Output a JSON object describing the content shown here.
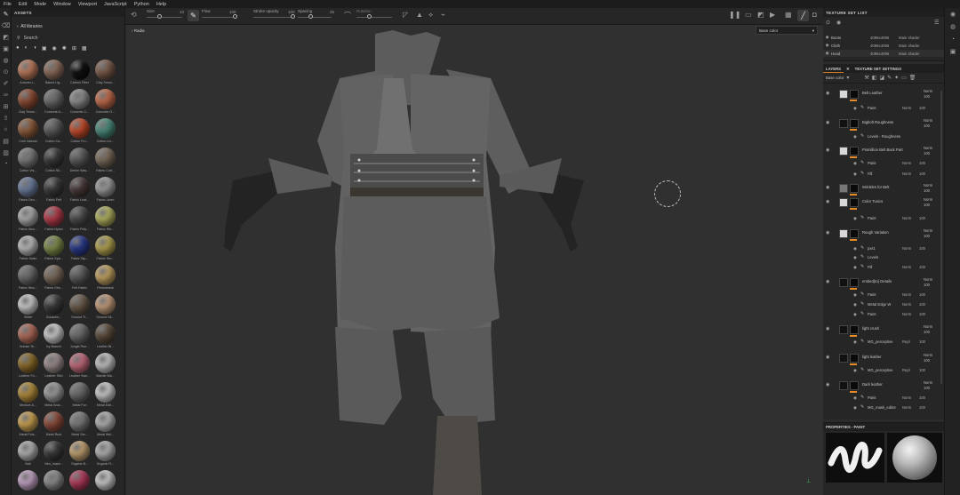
{
  "menu": [
    "File",
    "Edit",
    "Mode",
    "Window",
    "Viewport",
    "JavaScript",
    "Python",
    "Help"
  ],
  "toolbar": {
    "size_label": "Size",
    "size_value": "10",
    "flow_label": "Flow",
    "flow_value": "100",
    "stroke_opacity_label": "Stroke opacity",
    "stroke_opacity_value": "100",
    "spacing_label": "Spacing",
    "spacing_value": "25",
    "rotation_label": "Rotation"
  },
  "assets": {
    "title": "ASSETS",
    "library": "All libraries",
    "search_placeholder": "Search",
    "items": [
      {
        "label": "Autumn L...",
        "color": "#b8785a"
      },
      {
        "label": "Baked Lig...",
        "color": "#8a6a5a"
      },
      {
        "label": "Carbon Fiber",
        "color": "#111111"
      },
      {
        "label": "Clay Smoo...",
        "color": "#7a5a4a"
      },
      {
        "label": "Clay Terrac...",
        "color": "#8a4a32"
      },
      {
        "label": "Concrete A...",
        "color": "#6a6a6a"
      },
      {
        "label": "Concrete C...",
        "color": "#8b8b8b"
      },
      {
        "label": "Concrete G...",
        "color": "#c06a4a"
      },
      {
        "label": "Cork Natural",
        "color": "#8a5a3a"
      },
      {
        "label": "Cotton Ca...",
        "color": "#5a5a5a"
      },
      {
        "label": "Cotton Fro...",
        "color": "#c04a2a"
      },
      {
        "label": "Cotton Lin...",
        "color": "#4a8a7a"
      },
      {
        "label": "Cotton Vis...",
        "color": "#7a7a7a"
      },
      {
        "label": "Cotton Sk...",
        "color": "#3a3a3a"
      },
      {
        "label": "Denim Was...",
        "color": "#5a5a5a"
      },
      {
        "label": "Fabric Cott...",
        "color": "#7a6a5a"
      },
      {
        "label": "Fabric Den...",
        "color": "#6a7a9a"
      },
      {
        "label": "Fabric Felt",
        "color": "#3a3a3a"
      },
      {
        "label": "Fabric Leat...",
        "color": "#4a3a3a"
      },
      {
        "label": "Fabric Linen",
        "color": "#9a9a9a"
      },
      {
        "label": "Fabric Mus...",
        "color": "#aaaaaa"
      },
      {
        "label": "Fabric Nylon",
        "color": "#b03a4a"
      },
      {
        "label": "Fabric Poly...",
        "color": "#4a4a4a"
      },
      {
        "label": "Fabric Rib...",
        "color": "#b0b060"
      },
      {
        "label": "Fabric Swim",
        "color": "#b8b8b8"
      },
      {
        "label": "Fabric Spa...",
        "color": "#7a8a4a"
      },
      {
        "label": "Fabric Tap...",
        "color": "#2a3a8a"
      },
      {
        "label": "Fabric Terr...",
        "color": "#b0a050"
      },
      {
        "label": "Fabric Woo...",
        "color": "#6a6a6a"
      },
      {
        "label": "Fabric Sho...",
        "color": "#7a6a5a"
      },
      {
        "label": "Felt Fabric",
        "color": "#5a5a5a"
      },
      {
        "label": "Fleshwheat",
        "color": "#c0a060"
      },
      {
        "label": "Glitter",
        "color": "#c8c8c8"
      },
      {
        "label": "Gouache...",
        "color": "#3a3a3a"
      },
      {
        "label": "Ground Ti...",
        "color": "#6a5a4a"
      },
      {
        "label": "Ground Sk...",
        "color": "#c09a7a"
      },
      {
        "label": "Human Te...",
        "color": "#b06a5a"
      },
      {
        "label": "Ivy Branch",
        "color": "#c8c8c8"
      },
      {
        "label": "Jungle Run...",
        "color": "#6a6a6a"
      },
      {
        "label": "Leather Bl...",
        "color": "#5a4a3a"
      },
      {
        "label": "Leather Fo...",
        "color": "#8a6a2a"
      },
      {
        "label": "Leather Skin",
        "color": "#9a8a8a"
      },
      {
        "label": "Leather Swe...",
        "color": "#c06a7a"
      },
      {
        "label": "Marble Wa...",
        "color": "#c0c0c0"
      },
      {
        "label": "Medium A...",
        "color": "#b08a3a"
      },
      {
        "label": "Metal Brus...",
        "color": "#9a9a9a"
      },
      {
        "label": "Metal Fon",
        "color": "#6a6a6a"
      },
      {
        "label": "Metal Edit...",
        "color": "#c8c8c8"
      },
      {
        "label": "Metal Pols...",
        "color": "#c8a050"
      },
      {
        "label": "Metal Rust",
        "color": "#8a4a3a"
      },
      {
        "label": "Metal Ser...",
        "color": "#7a7a7a"
      },
      {
        "label": "Metal Wel...",
        "color": "#b0b0b0"
      },
      {
        "label": "Nail",
        "color": "#b0b0b0"
      },
      {
        "label": "Neo_mase...",
        "color": "#3a3a3a"
      },
      {
        "label": "Organic B...",
        "color": "#c0a070"
      },
      {
        "label": "Organic Fl...",
        "color": "#b0b0b0"
      },
      {
        "label": "",
        "color": "#c0a0c0"
      },
      {
        "label": "",
        "color": "#8a8a8a"
      },
      {
        "label": "",
        "color": "#b03a5a"
      },
      {
        "label": "",
        "color": "#c8c8c8"
      }
    ]
  },
  "viewport": {
    "tab": "Radia",
    "channel_select": "Base color"
  },
  "texture_set_list": {
    "title": "TEXTURE SET LIST",
    "rows": [
      {
        "name": "Boots",
        "res": "4096x4096",
        "shader": "Main shader"
      },
      {
        "name": "Cloth",
        "res": "4096x4096",
        "shader": "Main shader"
      },
      {
        "name": "Hood",
        "res": "4096x4096",
        "shader": "Main shader"
      }
    ]
  },
  "layers_panel": {
    "tab_layers": "LAYERS",
    "tab_settings": "TEXTURE SET SETTINGS",
    "channel": "Base color",
    "layers": [
      {
        "name": "Belt Leather",
        "blend": "Norm",
        "opacity": "100",
        "thumb": "light"
      },
      {
        "name": "Bigbolt Roughness",
        "blend": "Norm",
        "opacity": "100",
        "thumb": "dark"
      },
      {
        "name": "Pinmillion Belt Back Part",
        "blend": "Norm",
        "opacity": "100",
        "thumb": "light"
      },
      {
        "name": "Wrinkles for Belt",
        "blend": "Norm",
        "opacity": "100",
        "thumb": "grey"
      },
      {
        "name": "Color Tunics",
        "blend": "Norm",
        "opacity": "100",
        "thumb": "light"
      },
      {
        "name": "Rough Variation",
        "blend": "Norm",
        "opacity": "100",
        "thumb": "light"
      },
      {
        "name": "embed(to) Details",
        "blend": "Norm",
        "opacity": "100",
        "thumb": "dark"
      },
      {
        "name": "light crush",
        "blend": "Norm",
        "opacity": "100",
        "thumb": "dark"
      },
      {
        "name": "light leather",
        "blend": "Norm",
        "opacity": "100",
        "thumb": "dark"
      },
      {
        "name": "Dark leather",
        "blend": "Norm",
        "opacity": "100",
        "thumb": "dark"
      }
    ],
    "sub_rows": [
      {
        "name": "Paint",
        "blend": "Norm",
        "opacity": "100"
      },
      {
        "name": "Levels - Roughness",
        "blend": "",
        "opacity": ""
      },
      {
        "name": "Paint",
        "blend": "Norm",
        "opacity": "100"
      },
      {
        "name": "Fill",
        "blend": "Norm",
        "opacity": "100"
      },
      {
        "name": "Paint",
        "blend": "Norm",
        "opacity": "100"
      },
      {
        "name": "pxs1",
        "blend": "Norm",
        "opacity": "100"
      },
      {
        "name": "Levels",
        "blend": "",
        "opacity": ""
      },
      {
        "name": "Fill",
        "blend": "Norm",
        "opacity": "100"
      },
      {
        "name": "Paint",
        "blend": "Norm",
        "opacity": "100"
      },
      {
        "name": "Metal Edge W",
        "blend": "Norm",
        "opacity": "100"
      },
      {
        "name": "Paint",
        "blend": "Norm",
        "opacity": "100"
      },
      {
        "name": "MG_perceptive",
        "blend": "Repl",
        "opacity": "100"
      },
      {
        "name": "MG_perceptive",
        "blend": "Repl",
        "opacity": "100"
      },
      {
        "name": "Paint",
        "blend": "Norm",
        "opacity": "100"
      },
      {
        "name": "MG_mask_editor",
        "blend": "Norm",
        "opacity": "100"
      }
    ]
  },
  "properties": {
    "title": "PROPERTIES - PAINT"
  }
}
